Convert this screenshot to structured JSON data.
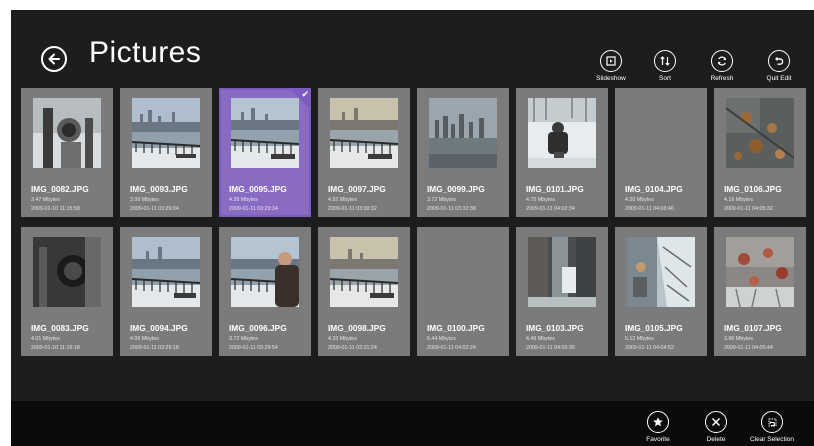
{
  "header": {
    "title": "Pictures",
    "commands": [
      {
        "label": "Slideshow",
        "icon": "slideshow-icon"
      },
      {
        "label": "Sort",
        "icon": "sort-icon"
      },
      {
        "label": "Refresh",
        "icon": "refresh-icon"
      },
      {
        "label": "Quit Edit",
        "icon": "undo-icon"
      }
    ]
  },
  "tiles": [
    {
      "name": "IMG_0082.JPG",
      "size": "3.47 Mbytes",
      "date": "2009-01-10 11:15:58",
      "photo": "camera"
    },
    {
      "name": "IMG_0093.JPG",
      "size": "3.99 Mbytes",
      "date": "2009-01-11 03:29:04",
      "photo": "skyline-bench"
    },
    {
      "name": "IMG_0095.JPG",
      "size": "4.28 Mbytes",
      "date": "2009-01-11 03:29:34",
      "photo": "skyline-bench",
      "selected": true
    },
    {
      "name": "IMG_0097.JPG",
      "size": "4.92 Mbytes",
      "date": "2009-01-11 03:30:32",
      "photo": "skyline-bench"
    },
    {
      "name": "IMG_0099.JPG",
      "size": "3.72 Mbytes",
      "date": "2009-01-11 03:32:38",
      "photo": "skyline"
    },
    {
      "name": "IMG_0101.JPG",
      "size": "4.75 Mbytes",
      "date": "2009-01-11 04:02:34",
      "photo": "snow-person"
    },
    {
      "name": "IMG_0104.JPG",
      "size": "4.20 Mbytes",
      "date": "2009-01-11 04:03:46",
      "photo": "none"
    },
    {
      "name": "IMG_0106.JPG",
      "size": "4.16 Mbytes",
      "date": "2009-01-11 04:05:32",
      "photo": "leaves"
    },
    {
      "name": "IMG_0083.JPG",
      "size": "4.01 Mbytes",
      "date": "2009-01-10 11:16:18",
      "photo": "camera-dark"
    },
    {
      "name": "IMG_0094.JPG",
      "size": "4.09 Mbytes",
      "date": "2009-01-11 03:29:18",
      "photo": "skyline-bench"
    },
    {
      "name": "IMG_0096.JPG",
      "size": "3.72 Mbytes",
      "date": "2009-01-11 03:29:54",
      "photo": "skyline-person"
    },
    {
      "name": "IMG_0098.JPG",
      "size": "4.33 Mbytes",
      "date": "2009-01-11 03:31:24",
      "photo": "skyline-bench"
    },
    {
      "name": "IMG_0100.JPG",
      "size": "5.44 Mbytes",
      "date": "2009-01-11 04:02:24",
      "photo": "none"
    },
    {
      "name": "IMG_0103.JPG",
      "size": "4.49 Mbytes",
      "date": "2009-01-11 04:03:30",
      "photo": "waterfall"
    },
    {
      "name": "IMG_0105.JPG",
      "size": "5.12 Mbytes",
      "date": "2009-01-11 04:04:52",
      "photo": "snow-tree"
    },
    {
      "name": "IMG_0107.JPG",
      "size": "3.96 Mbytes",
      "date": "2009-01-11 04:05:44",
      "photo": "leaves-red"
    }
  ],
  "appbar": {
    "buttons": [
      {
        "label": "Favorite",
        "icon": "star-icon"
      },
      {
        "label": "Delete",
        "icon": "close-icon"
      },
      {
        "label": "Clear Selection",
        "icon": "clear-selection-icon"
      }
    ]
  },
  "colors": {
    "background": "#1d1d1d",
    "tile": "#7b7b7b",
    "selected": "#7c5cc0",
    "appbar": "#0b0b0b"
  }
}
